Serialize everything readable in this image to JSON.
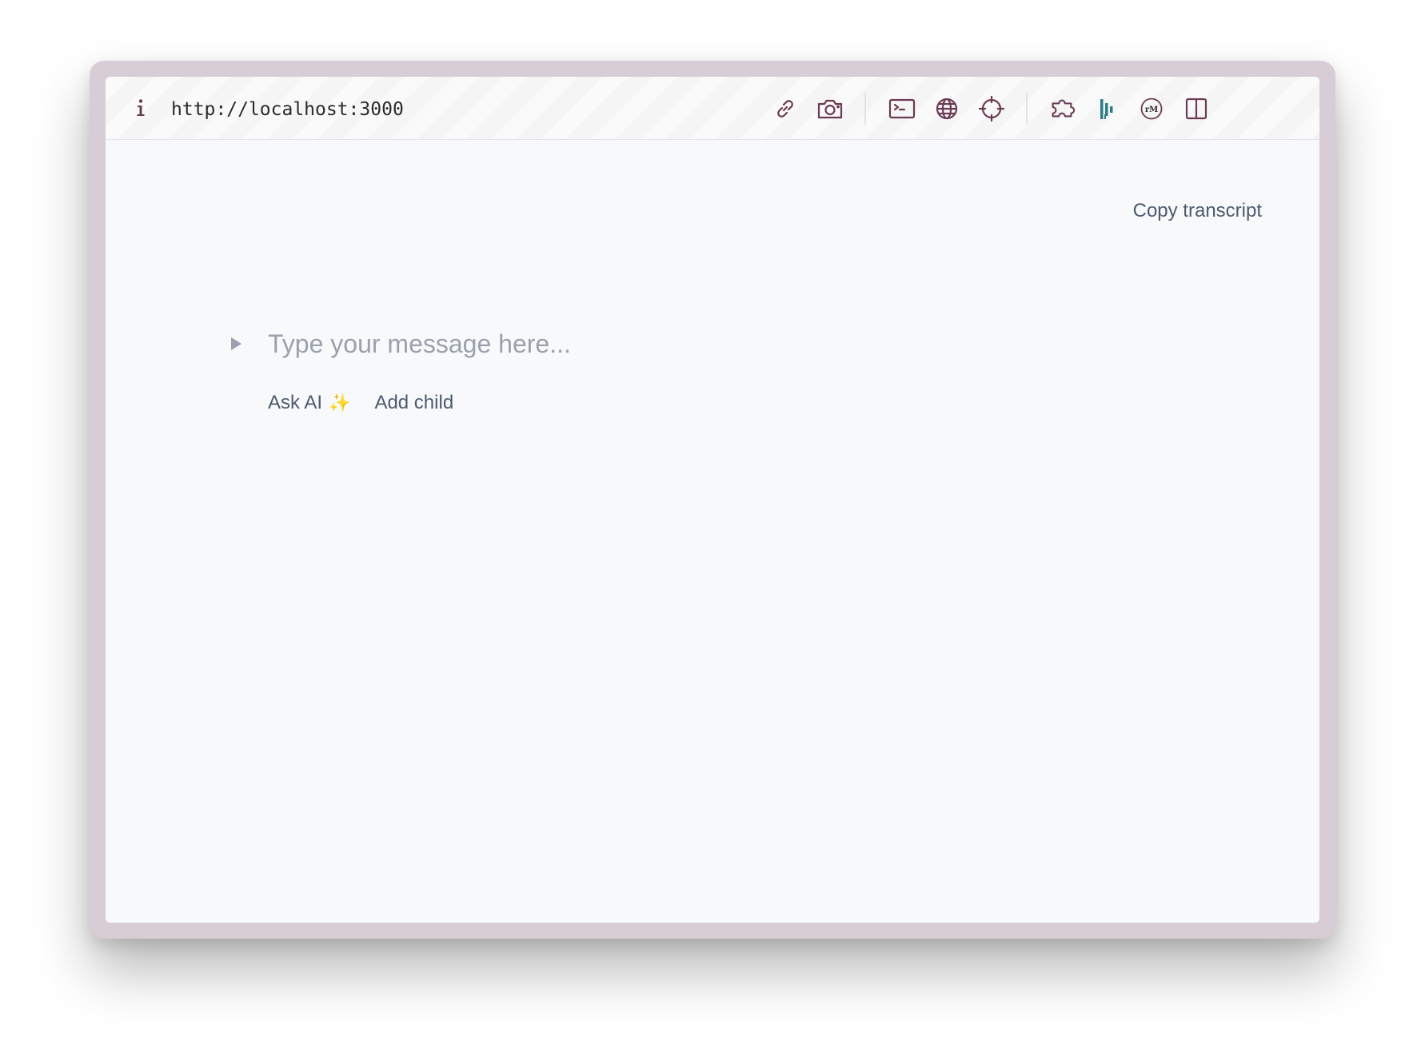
{
  "toolbar": {
    "url": "http://localhost:3000",
    "icons": {
      "info": "info-icon",
      "link": "link-icon",
      "camera": "camera-icon",
      "terminal": "terminal-icon",
      "globe": "globe-icon",
      "crosshair": "crosshair-icon",
      "extensions": "puzzle-icon",
      "devtools": "bars-logo-icon",
      "rm": "rm-logo-icon",
      "split": "split-view-icon"
    },
    "rm_label": "rM"
  },
  "main": {
    "copy_transcript": "Copy transcript",
    "message_placeholder": "Type your message here...",
    "ask_ai": "Ask AI",
    "sparkle": "✨",
    "add_child": "Add child"
  },
  "colors": {
    "icon": "#6b3a52",
    "accent_teal": "#2f7a8c",
    "text_muted": "#4d5b6f",
    "placeholder": "#9aa1ad",
    "frame": "#d9cdd5",
    "background": "#f8f9fb"
  }
}
